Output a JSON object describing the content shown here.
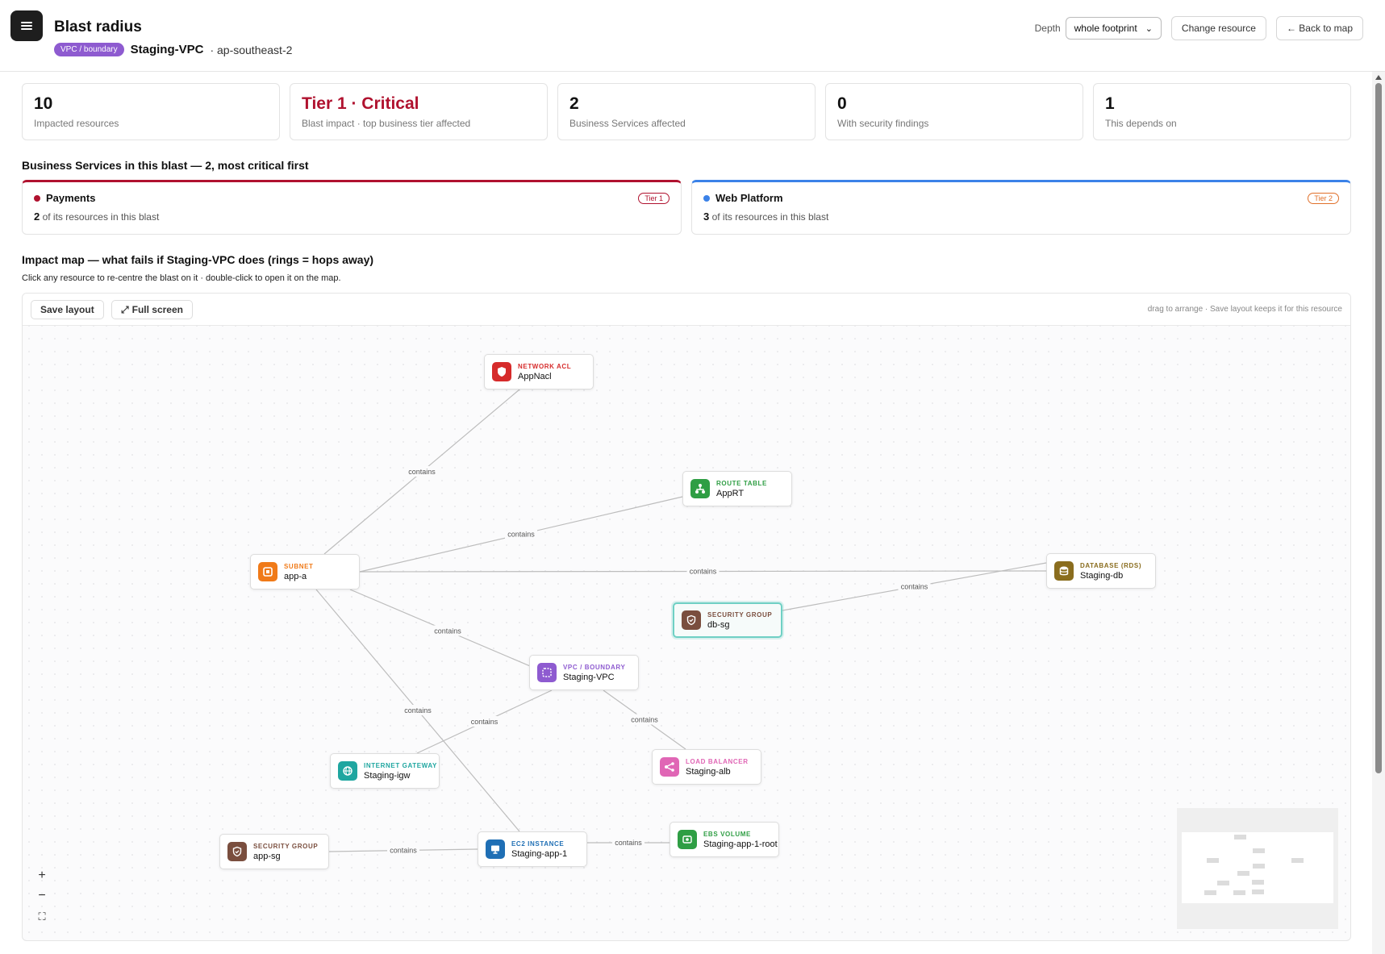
{
  "header": {
    "title": "Blast radius",
    "type_badge": "VPC / boundary",
    "resource_name": "Staging-VPC",
    "region": "· ap-southeast-2",
    "depth_label": "Depth",
    "depth_value": "whole footprint",
    "change_resource": "Change resource",
    "back_to_map": "← Back to map"
  },
  "stats": [
    {
      "value": "10",
      "label": "Impacted resources"
    },
    {
      "value": "Tier 1 · Critical",
      "label": "Blast impact · top business tier affected"
    },
    {
      "value": "2",
      "label": "Business Services affected"
    },
    {
      "value": "0",
      "label": "With security findings"
    },
    {
      "value": "1",
      "label": "This depends on"
    }
  ],
  "services_heading": "Business Services in this blast — 2, most critical first",
  "services": [
    {
      "name": "Payments",
      "count": "2",
      "count_text": "of its resources in this blast",
      "tier": "Tier 1",
      "color": "#b0122f"
    },
    {
      "name": "Web Platform",
      "count": "3",
      "count_text": "of its resources in this blast",
      "tier": "Tier 2",
      "color": "#3b82e8",
      "tier_color": "#e0702a"
    }
  ],
  "impact": {
    "heading": "Impact map — what fails if Staging-VPC does (rings = hops away)",
    "hint": "Click any resource to re-centre the blast on it · double-click to open it on the map.",
    "save_layout": "Save layout",
    "full_screen": "Full screen",
    "note": "drag to arrange · Save layout keeps it for this resource",
    "edge_label": "contains"
  },
  "nodes": [
    {
      "id": "appnacl",
      "type": "NETWORK ACL",
      "name": "AppNacl",
      "color": "#d62b2b",
      "icon": "shield-icon"
    },
    {
      "id": "apprt",
      "type": "ROUTE TABLE",
      "name": "AppRT",
      "color": "#2f9e44",
      "icon": "route-table-icon"
    },
    {
      "id": "app-a",
      "type": "SUBNET",
      "name": "app-a",
      "color": "#f07a18",
      "icon": "subnet-icon"
    },
    {
      "id": "staging-db",
      "type": "DATABASE (RDS)",
      "name": "Staging-db",
      "color": "#8a6d1e",
      "icon": "database-icon"
    },
    {
      "id": "db-sg",
      "type": "SECURITY GROUP",
      "name": "db-sg",
      "color": "#7a4e3e",
      "icon": "security-group-icon"
    },
    {
      "id": "staging-vpc",
      "type": "VPC / BOUNDARY",
      "name": "Staging-VPC",
      "color": "#8e5bd0",
      "icon": "vpc-icon"
    },
    {
      "id": "staging-igw",
      "type": "INTERNET GATEWAY",
      "name": "Staging-igw",
      "color": "#1fa6a0",
      "icon": "globe-icon"
    },
    {
      "id": "staging-alb",
      "type": "LOAD BALANCER",
      "name": "Staging-alb",
      "color": "#e066b5",
      "icon": "load-balancer-icon"
    },
    {
      "id": "app-sg",
      "type": "SECURITY GROUP",
      "name": "app-sg",
      "color": "#7a4e3e",
      "icon": "security-group-icon"
    },
    {
      "id": "staging-app-1",
      "type": "EC2 INSTANCE",
      "name": "Staging-app-1",
      "color": "#1f6fb5",
      "icon": "monitor-icon"
    },
    {
      "id": "staging-app-1-root",
      "type": "EBS VOLUME",
      "name": "Staging-app-1-root",
      "color": "#2f9e44",
      "icon": "volume-icon"
    }
  ],
  "edges": [
    {
      "from": "app-a",
      "to": "appnacl",
      "label": "contains"
    },
    {
      "from": "app-a",
      "to": "apprt",
      "label": "contains"
    },
    {
      "from": "app-a",
      "to": "staging-db",
      "label": "contains"
    },
    {
      "from": "db-sg",
      "to": "staging-db",
      "label": "contains"
    },
    {
      "from": "app-a",
      "to": "staging-vpc",
      "label": "contains"
    },
    {
      "from": "app-a",
      "to": "staging-app-1",
      "label": "contains"
    },
    {
      "from": "staging-vpc",
      "to": "staging-igw",
      "label": "contains"
    },
    {
      "from": "staging-vpc",
      "to": "staging-alb",
      "label": "contains"
    },
    {
      "from": "app-sg",
      "to": "staging-app-1",
      "label": "contains"
    },
    {
      "from": "staging-app-1",
      "to": "staging-app-1-root",
      "label": "contains"
    }
  ],
  "selected_node": "db-sg"
}
